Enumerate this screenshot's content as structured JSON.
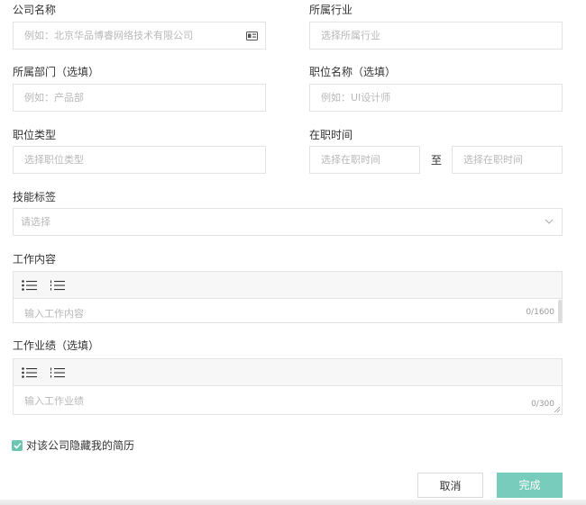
{
  "form": {
    "company": {
      "label": "公司名称",
      "placeholder": "例如：北京华品博睿网络技术有限公司",
      "icon": "id-card-icon"
    },
    "industry": {
      "label": "所属行业",
      "placeholder": "选择所属行业"
    },
    "department": {
      "label": "所属部门（选填）",
      "placeholder": "例如：产品部"
    },
    "position_name": {
      "label": "职位名称（选填）",
      "placeholder": "例如：UI设计师"
    },
    "position_type": {
      "label": "职位类型",
      "placeholder": "选择职位类型"
    },
    "tenure": {
      "label": "在职时间",
      "start_placeholder": "选择在职时间",
      "separator": "至",
      "end_placeholder": "选择在职时间"
    },
    "skills": {
      "label": "技能标签",
      "placeholder": "请选择",
      "icon": "chevron-down-icon"
    },
    "work_content": {
      "label": "工作内容",
      "placeholder": "输入工作内容",
      "count": "0/1600"
    },
    "achievements": {
      "label": "工作业绩（选填）",
      "placeholder": "输入工作业绩",
      "count": "0/300"
    },
    "hide_resume": {
      "label": "对该公司隐藏我的简历",
      "checked": true
    }
  },
  "actions": {
    "cancel": "取消",
    "done": "完成"
  },
  "colors": {
    "accent": "#6cc5b0",
    "done_button": "#78ccbb",
    "border": "#e3e3e3",
    "placeholder": "#b8b8b8"
  }
}
